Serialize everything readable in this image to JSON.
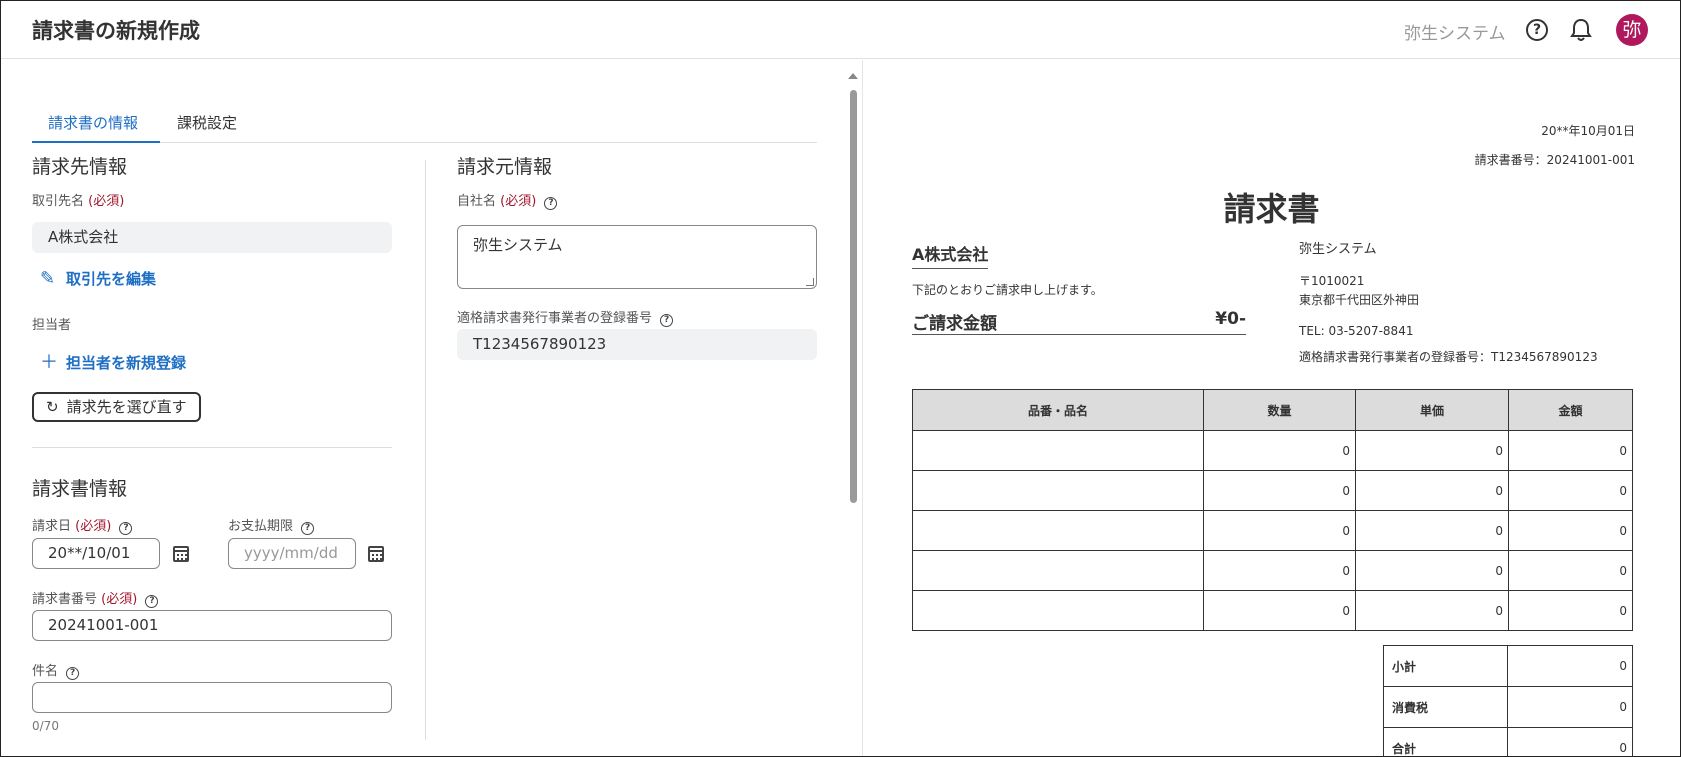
{
  "header": {
    "title": "請求書の新規作成",
    "company": "弥生システム",
    "help": "?",
    "avatar": "弥"
  },
  "tabs": [
    {
      "label": "請求書の情報",
      "active": true
    },
    {
      "label": "課税設定",
      "active": false
    }
  ],
  "billing_to": {
    "title": "請求先情報",
    "partner_label": "取引先名",
    "required": "(必須)",
    "partner_value": "A株式会社",
    "edit_link": "取引先を編集",
    "person_label": "担当者",
    "register_link": "担当者を新規登録",
    "reselect_button": "請求先を選び直す"
  },
  "billing_from": {
    "title": "請求元情報",
    "company_label": "自社名",
    "required": "(必須)",
    "company_value": "弥生システム",
    "reg_label": "適格請求書発行事業者の登録番号",
    "reg_value": "T1234567890123"
  },
  "invoice_info": {
    "title": "請求書情報",
    "date_label": "請求日",
    "required": "(必須)",
    "date_value": "20**/10/01",
    "due_label": "お支払期限",
    "due_placeholder": "yyyy/mm/dd",
    "number_label": "請求書番号",
    "number_value": "20241001-001",
    "subject_label": "件名",
    "subject_value": "",
    "subject_counter": "0/70"
  },
  "preview": {
    "date": "20**年10月01日",
    "number": "請求書番号：20241001-001",
    "title": "請求書",
    "to": "A株式会社",
    "message": "下記のとおりご請求申し上げます。",
    "amount_label": "ご請求金額",
    "amount_value": "¥0-",
    "from_company": "弥生システム",
    "from_zip": "〒1010021",
    "from_address": "東京都千代田区外神田",
    "from_tel": "TEL: 03-5207-8841",
    "from_reg": "適格請求書発行事業者の登録番号：T1234567890123",
    "columns": [
      "品番・品名",
      "数量",
      "単価",
      "金額"
    ],
    "rows": [
      [
        "",
        "0",
        "0",
        "0"
      ],
      [
        "",
        "0",
        "0",
        "0"
      ],
      [
        "",
        "0",
        "0",
        "0"
      ],
      [
        "",
        "0",
        "0",
        "0"
      ],
      [
        "",
        "0",
        "0",
        "0"
      ]
    ],
    "totals": [
      {
        "label": "小計",
        "value": "0"
      },
      {
        "label": "消費税",
        "value": "0"
      },
      {
        "label": "合計",
        "value": "0"
      }
    ]
  },
  "colors": {
    "accent": "#1f6fc5",
    "required": "#a0182f",
    "avatar": "#b0185e"
  },
  "icons": [
    "help-icon",
    "bell-icon",
    "pencil-icon",
    "plus-icon",
    "refresh-icon",
    "calendar-icon",
    "question-icon"
  ]
}
